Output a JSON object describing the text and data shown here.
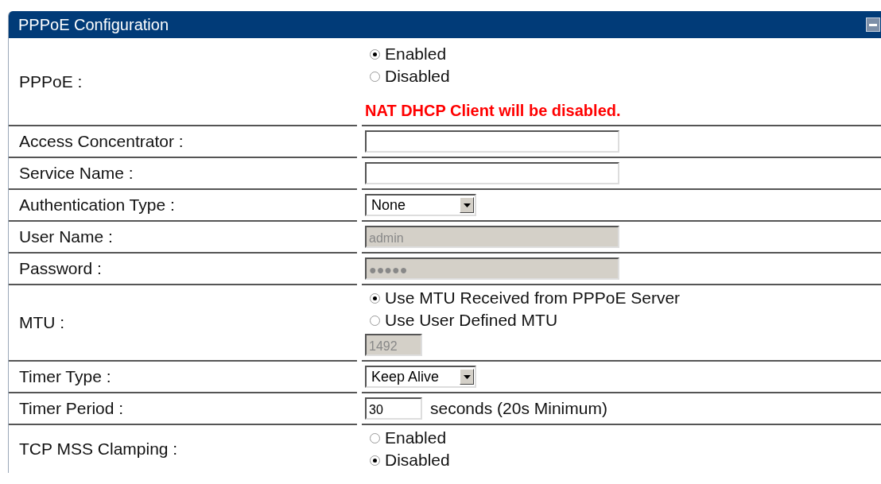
{
  "panel": {
    "title": "PPPoE Configuration",
    "collapsed": false
  },
  "rows": [
    {
      "kind": "radio",
      "label": "PPPoE :",
      "options": [
        {
          "label": "Enabled",
          "selected": true
        },
        {
          "label": "Disabled",
          "selected": false
        }
      ],
      "note": "NAT DHCP Client will be disabled."
    },
    {
      "kind": "text",
      "label": "Access Concentrator :",
      "value": "",
      "disabled": false
    },
    {
      "kind": "text",
      "label": "Service Name :",
      "value": "",
      "disabled": false
    },
    {
      "kind": "select",
      "label": "Authentication Type :",
      "value": "None"
    },
    {
      "kind": "text",
      "label": "User Name :",
      "value": "admin",
      "disabled": true
    },
    {
      "kind": "text",
      "label": "Password :",
      "value": "●●●●●",
      "disabled": true
    },
    {
      "kind": "radio",
      "label": "MTU :",
      "options": [
        {
          "label": "Use MTU Received from PPPoE Server",
          "selected": true
        },
        {
          "label": "Use User Defined MTU",
          "selected": false
        }
      ],
      "field": {
        "value": "1492",
        "disabled": true
      }
    },
    {
      "kind": "select",
      "label": "Timer Type :",
      "value": "Keep Alive"
    },
    {
      "kind": "text",
      "label": "Timer Period :",
      "value": "30",
      "disabled": false,
      "suffix": "seconds (20s Minimum)"
    },
    {
      "kind": "radio",
      "label": "TCP MSS Clamping :",
      "options": [
        {
          "label": "Enabled",
          "selected": false
        },
        {
          "label": "Disabled",
          "selected": true
        }
      ]
    }
  ]
}
